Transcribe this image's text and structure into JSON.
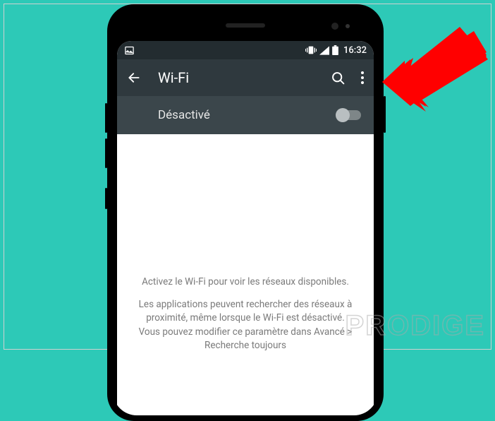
{
  "status_bar": {
    "time": "16:32"
  },
  "app_bar": {
    "title": "Wi-Fi"
  },
  "toggle": {
    "label": "Désactivé",
    "state": "off"
  },
  "content": {
    "heading": "Activez le Wi-Fi pour voir les réseaux disponibles.",
    "body": "Les applications peuvent rechercher des réseaux à proximité, même lorsque le Wi-Fi est désactivé. Vous pouvez modifier ce paramètre dans Avancé > Recherche toujours"
  },
  "icons": {
    "back": "back-arrow-icon",
    "search": "search-icon",
    "overflow": "more-vert-icon",
    "vibrate": "vibrate-icon",
    "signal": "cell-signal-icon",
    "battery": "battery-icon",
    "picture": "picture-icon"
  },
  "watermark": "PRODIGE"
}
